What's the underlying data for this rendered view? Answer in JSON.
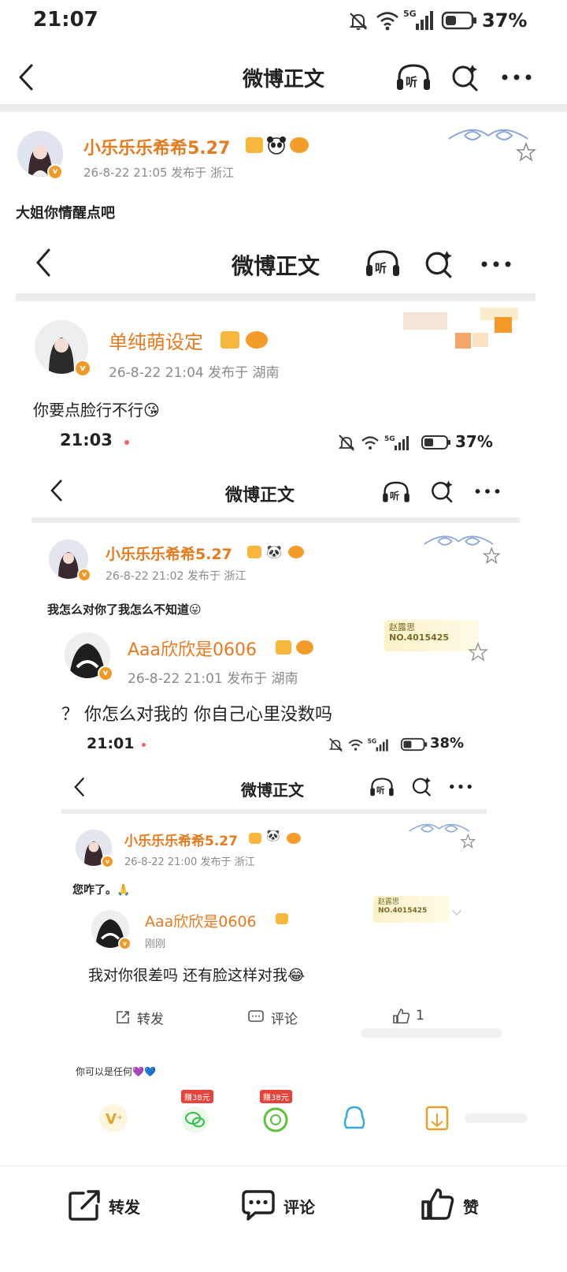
{
  "status": {
    "time": "21:07",
    "battery": "37%"
  },
  "nav": {
    "title": "微博正文"
  },
  "post": {
    "author": "小乐乐乐希希5.27",
    "meta": "26-8-22 21:05  发布于 浙江",
    "text": "大姐你情醒点吧"
  },
  "shot1": {
    "nav_title": "微博正文",
    "author": "单纯萌设定",
    "meta": "26-8-22 21:04  发布于 湖南",
    "text": "你要点脸行不行😘"
  },
  "shot2": {
    "time": "21:03",
    "battery": "37%",
    "nav_title": "微博正文",
    "author": "小乐乐乐希希5.27",
    "meta": "26-8-22 21:02  发布于 浙江",
    "text": "我怎么对你了我怎么不知道😛",
    "quoted_author": "Aaa欣欣是0606",
    "quoted_meta": "26-8-22 21:01  发布于 湖南",
    "quoted_text": "？ 你怎么对我的 你自己心里没数吗",
    "coin_line1": "赵露思",
    "coin_line2": "NO.4015425"
  },
  "shot3": {
    "time": "21:01",
    "battery": "38%",
    "nav_title": "微博正文",
    "author": "小乐乐乐希希5.27",
    "meta": "26-8-22 21:00  发布于 浙江",
    "text": "您咋了。🙏",
    "quoted_author": "Aaa欣欣是0606",
    "quoted_meta": "刚刚",
    "quoted_text": "我对你很差吗 还有脸这样对我😂",
    "coin_line1": "赵露思",
    "coin_line2": "NO.4015425",
    "repost": "转发",
    "comment": "评论",
    "like_count": "1",
    "footer_text": "你可以是任何💜💙",
    "tag1": "赚38元",
    "tag2": "赚38元"
  },
  "actions": {
    "repost": "转发",
    "comment": "评论",
    "like": "赞"
  },
  "colors": {
    "accent": "#e87a1e",
    "badge": "#f29a26"
  }
}
